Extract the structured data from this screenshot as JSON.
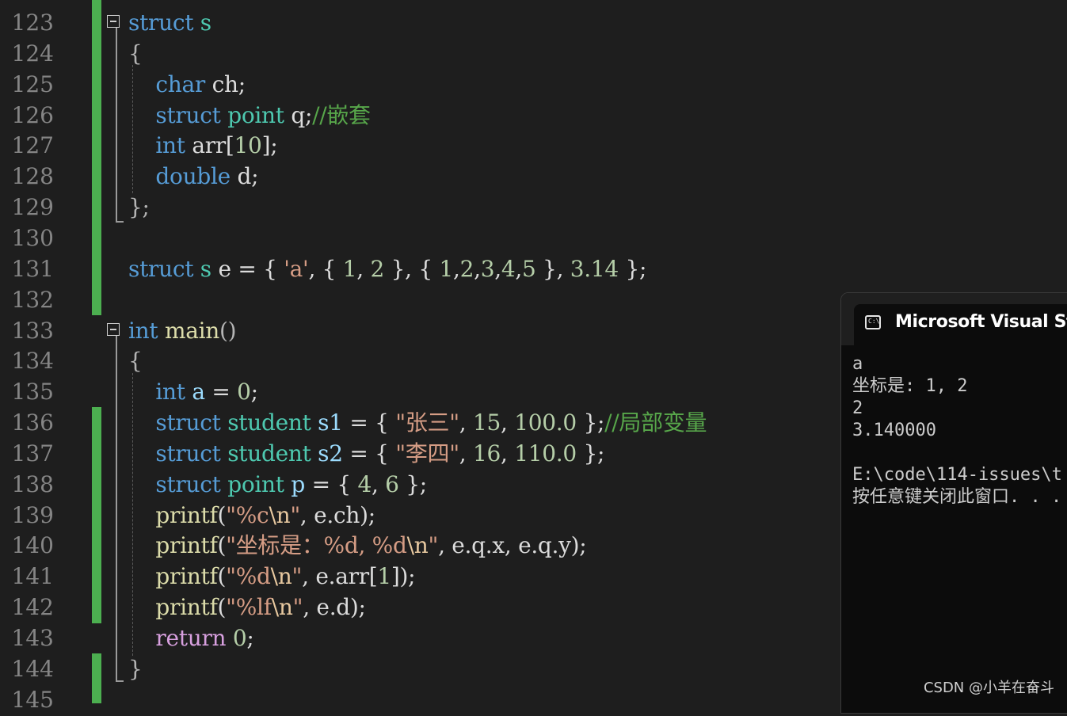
{
  "editor": {
    "line_numbers": [
      "123",
      "124",
      "125",
      "126",
      "127",
      "128",
      "129",
      "130",
      "131",
      "132",
      "133",
      "134",
      "135",
      "136",
      "137",
      "138",
      "139",
      "140",
      "141",
      "142",
      "143",
      "144",
      "145"
    ],
    "lines": [
      [
        [
          "kw",
          "struct"
        ],
        [
          "",
          "·"
        ],
        [
          "type",
          "s"
        ]
      ],
      [
        [
          "punc",
          "{"
        ]
      ],
      [
        [
          "",
          "    "
        ],
        [
          "kw",
          "char"
        ],
        [
          "",
          " ch;"
        ]
      ],
      [
        [
          "",
          "    "
        ],
        [
          "kw",
          "struct"
        ],
        [
          "",
          " "
        ],
        [
          "type",
          "point"
        ],
        [
          "",
          " q;"
        ],
        [
          "cmt",
          "//嵌套"
        ]
      ],
      [
        [
          "",
          "    "
        ],
        [
          "kw",
          "int"
        ],
        [
          "",
          " arr["
        ],
        [
          "num",
          "10"
        ],
        [
          "",
          "];"
        ]
      ],
      [
        [
          "",
          "    "
        ],
        [
          "kw",
          "double"
        ],
        [
          "",
          " d;"
        ]
      ],
      [
        [
          "punc",
          "};"
        ]
      ],
      [],
      [
        [
          "kw",
          "struct"
        ],
        [
          "",
          " "
        ],
        [
          "type",
          "s"
        ],
        [
          "",
          " e = { "
        ],
        [
          "str",
          "'a'"
        ],
        [
          "",
          ", { "
        ],
        [
          "num",
          "1"
        ],
        [
          "",
          ", "
        ],
        [
          "num",
          "2"
        ],
        [
          "",
          " }, { "
        ],
        [
          "num",
          "1"
        ],
        [
          "",
          ","
        ],
        [
          "num",
          "2"
        ],
        [
          "",
          ","
        ],
        [
          "num",
          "3"
        ],
        [
          "",
          ","
        ],
        [
          "num",
          "4"
        ],
        [
          "",
          ","
        ],
        [
          "num",
          "5"
        ],
        [
          "",
          " }, "
        ],
        [
          "num",
          "3.14"
        ],
        [
          "",
          " };"
        ]
      ],
      [],
      [
        [
          "kw",
          "int"
        ],
        [
          "",
          " "
        ],
        [
          "fn",
          "main"
        ],
        [
          "punc",
          "()"
        ]
      ],
      [
        [
          "punc",
          "{"
        ]
      ],
      [
        [
          "",
          "    "
        ],
        [
          "kw",
          "int"
        ],
        [
          "",
          " "
        ],
        [
          "var",
          "a"
        ],
        [
          "",
          " = "
        ],
        [
          "num",
          "0"
        ],
        [
          "",
          ";"
        ]
      ],
      [
        [
          "",
          "    "
        ],
        [
          "kw",
          "struct"
        ],
        [
          "",
          " "
        ],
        [
          "type",
          "student"
        ],
        [
          "",
          " "
        ],
        [
          "var",
          "s1"
        ],
        [
          "",
          " = { "
        ],
        [
          "str",
          "\"张三\""
        ],
        [
          "",
          ", "
        ],
        [
          "num",
          "15"
        ],
        [
          "",
          ", "
        ],
        [
          "num",
          "100.0"
        ],
        [
          "",
          " };"
        ],
        [
          "cmt",
          "//局部变量"
        ]
      ],
      [
        [
          "",
          "    "
        ],
        [
          "kw",
          "struct"
        ],
        [
          "",
          " "
        ],
        [
          "type",
          "student"
        ],
        [
          "",
          " "
        ],
        [
          "var",
          "s2"
        ],
        [
          "",
          " = { "
        ],
        [
          "str",
          "\"李四\""
        ],
        [
          "",
          ", "
        ],
        [
          "num",
          "16"
        ],
        [
          "",
          ", "
        ],
        [
          "num",
          "110.0"
        ],
        [
          "",
          " };"
        ]
      ],
      [
        [
          "",
          "    "
        ],
        [
          "kw",
          "struct"
        ],
        [
          "",
          " "
        ],
        [
          "type",
          "point"
        ],
        [
          "",
          " "
        ],
        [
          "var",
          "p"
        ],
        [
          "",
          " = { "
        ],
        [
          "num",
          "4"
        ],
        [
          "",
          ", "
        ],
        [
          "num",
          "6"
        ],
        [
          "",
          " };"
        ]
      ],
      [
        [
          "",
          "    "
        ],
        [
          "fn",
          "printf"
        ],
        [
          "",
          "("
        ],
        [
          "str",
          "\"%c"
        ],
        [
          "esc",
          "\\n"
        ],
        [
          "str",
          "\""
        ],
        [
          "",
          ", e.ch);"
        ]
      ],
      [
        [
          "",
          "    "
        ],
        [
          "fn",
          "printf"
        ],
        [
          "",
          "("
        ],
        [
          "str",
          "\"坐标是：%d, %d"
        ],
        [
          "esc",
          "\\n"
        ],
        [
          "str",
          "\""
        ],
        [
          "",
          ", e.q.x, e.q.y);"
        ]
      ],
      [
        [
          "",
          "    "
        ],
        [
          "fn",
          "printf"
        ],
        [
          "",
          "("
        ],
        [
          "str",
          "\"%d"
        ],
        [
          "esc",
          "\\n"
        ],
        [
          "str",
          "\""
        ],
        [
          "",
          ", e.arr["
        ],
        [
          "num",
          "1"
        ],
        [
          "",
          "]);"
        ]
      ],
      [
        [
          "",
          "    "
        ],
        [
          "fn",
          "printf"
        ],
        [
          "",
          "("
        ],
        [
          "str",
          "\"%lf"
        ],
        [
          "esc",
          "\\n"
        ],
        [
          "str",
          "\""
        ],
        [
          "",
          ", e.d);"
        ]
      ],
      [
        [
          "",
          "    "
        ],
        [
          "ctl",
          "return"
        ],
        [
          "",
          " "
        ],
        [
          "num",
          "0"
        ],
        [
          "",
          ";"
        ]
      ],
      [
        [
          "punc",
          "}"
        ]
      ],
      []
    ]
  },
  "console": {
    "icon_label": "C:\\",
    "title": "Microsoft Visual Studio",
    "output": [
      "a",
      "坐标是: 1, 2",
      "2",
      "3.140000",
      "",
      "E:\\code\\114-issues\\t",
      "按任意键关闭此窗口. . ."
    ]
  },
  "watermark": "CSDN @小羊在奋斗",
  "colors": {
    "keyword": "#569cd6",
    "type": "#4ec9b0",
    "function": "#dcdcaa",
    "string": "#d69d85",
    "number": "#b5cea8",
    "comment": "#57a64a",
    "change_bar": "#4caf50"
  }
}
